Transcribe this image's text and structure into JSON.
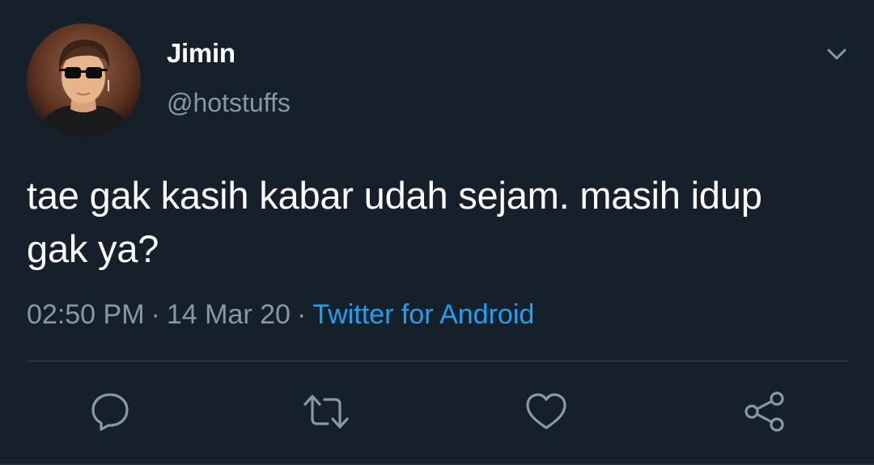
{
  "author": {
    "display_name": "Jimin",
    "handle": "@hotstuffs",
    "avatar_icon": "profile-photo"
  },
  "tweet": {
    "text_line1": "tae gak kasih kabar udah sejam. masih idup",
    "text_line2": "gak ya?",
    "time": "02:50 PM",
    "separator": "·",
    "date": "14 Mar 20",
    "source": "Twitter for Android"
  },
  "actions": [
    {
      "icon": "reply-icon"
    },
    {
      "icon": "retweet-icon"
    },
    {
      "icon": "like-icon"
    },
    {
      "icon": "share-icon"
    }
  ],
  "colors": {
    "background": "#15202b",
    "text": "#ffffff",
    "secondary": "#8899a6",
    "accent": "#1da1f2",
    "divider": "#38444d"
  }
}
